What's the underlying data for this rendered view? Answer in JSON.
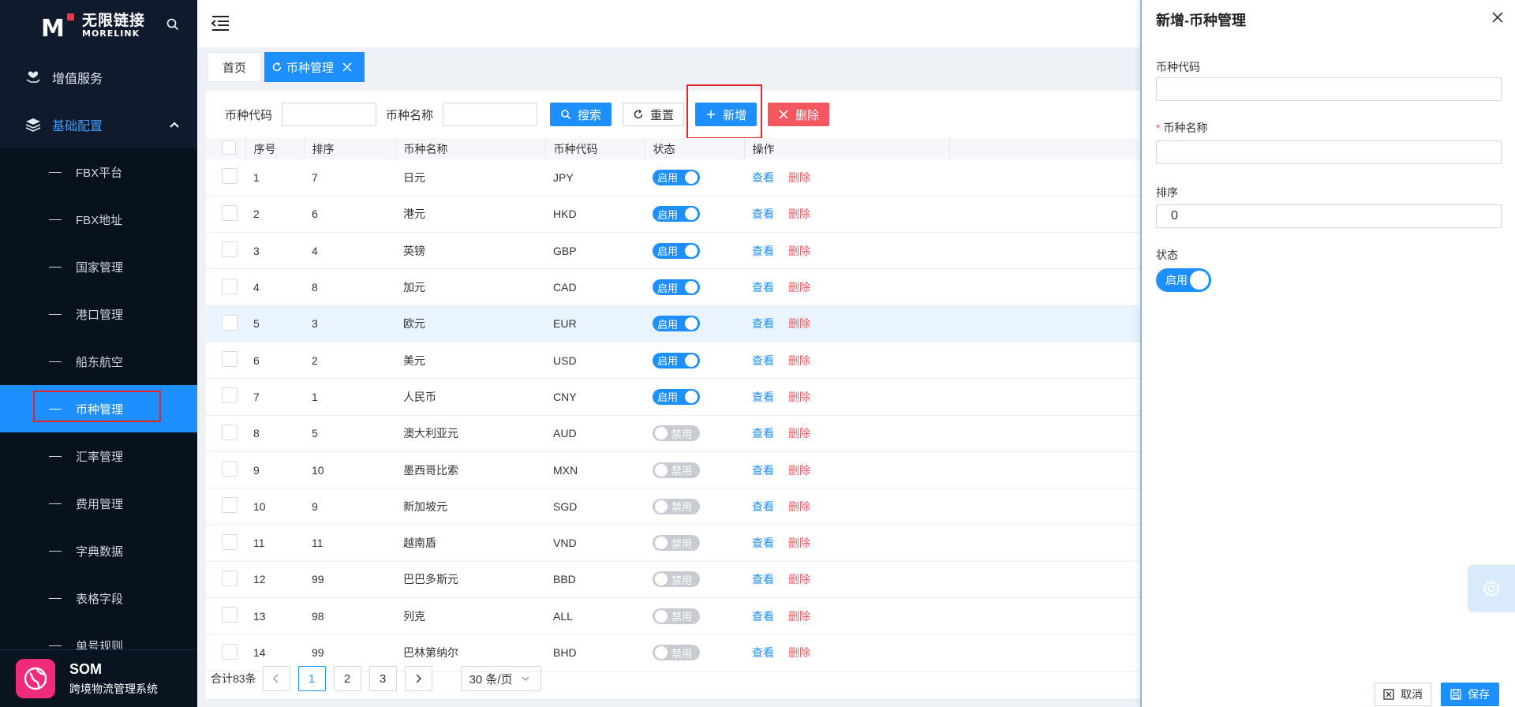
{
  "sidebar": {
    "brand_cn": "无限链接",
    "brand_en": "MORELINK",
    "menus": [
      {
        "label": "增值服务"
      },
      {
        "label": "基础配置"
      }
    ],
    "items": [
      {
        "label": "FBX平台"
      },
      {
        "label": "FBX地址"
      },
      {
        "label": "国家管理"
      },
      {
        "label": "港口管理"
      },
      {
        "label": "船东航空"
      },
      {
        "label": "币种管理"
      },
      {
        "label": "汇率管理"
      },
      {
        "label": "费用管理"
      },
      {
        "label": "字典数据"
      },
      {
        "label": "表格字段"
      },
      {
        "label": "单号规则"
      }
    ],
    "system_name": "SOM",
    "system_desc": "跨境物流管理系统"
  },
  "tabs": [
    {
      "label": "首页"
    },
    {
      "label": "币种管理"
    }
  ],
  "filters": {
    "code_label": "币种代码",
    "name_label": "币种名称",
    "search": "搜索",
    "reset": "重置",
    "add": "新增",
    "delete": "删除"
  },
  "table": {
    "headers": [
      "序号",
      "排序",
      "币种名称",
      "币种代码",
      "状态",
      "操作"
    ],
    "view": "查看",
    "del": "删除",
    "rows": [
      {
        "no": "1",
        "sort": "7",
        "name": "日元",
        "code": "JPY",
        "status": "启用"
      },
      {
        "no": "2",
        "sort": "6",
        "name": "港元",
        "code": "HKD",
        "status": "启用"
      },
      {
        "no": "3",
        "sort": "4",
        "name": "英镑",
        "code": "GBP",
        "status": "启用"
      },
      {
        "no": "4",
        "sort": "8",
        "name": "加元",
        "code": "CAD",
        "status": "启用"
      },
      {
        "no": "5",
        "sort": "3",
        "name": "欧元",
        "code": "EUR",
        "status": "启用"
      },
      {
        "no": "6",
        "sort": "2",
        "name": "美元",
        "code": "USD",
        "status": "启用"
      },
      {
        "no": "7",
        "sort": "1",
        "name": "人民币",
        "code": "CNY",
        "status": "启用"
      },
      {
        "no": "8",
        "sort": "5",
        "name": "澳大利亚元",
        "code": "AUD",
        "status": "禁用"
      },
      {
        "no": "9",
        "sort": "10",
        "name": "墨西哥比索",
        "code": "MXN",
        "status": "禁用"
      },
      {
        "no": "10",
        "sort": "9",
        "name": "新加坡元",
        "code": "SGD",
        "status": "禁用"
      },
      {
        "no": "11",
        "sort": "11",
        "name": "越南盾",
        "code": "VND",
        "status": "禁用"
      },
      {
        "no": "12",
        "sort": "99",
        "name": "巴巴多斯元",
        "code": "BBD",
        "status": "禁用"
      },
      {
        "no": "13",
        "sort": "98",
        "name": "列克",
        "code": "ALL",
        "status": "禁用"
      },
      {
        "no": "14",
        "sort": "99",
        "name": "巴林第纳尔",
        "code": "BHD",
        "status": "禁用"
      }
    ]
  },
  "pager": {
    "total": "合计83条",
    "pages": [
      "1",
      "2",
      "3"
    ],
    "page_size": "30 条/页"
  },
  "drawer": {
    "title": "新增-币种管理",
    "code_label": "币种代码",
    "name_label": "币种名称",
    "required_mark": "*",
    "sort_label": "排序",
    "sort_value": "0",
    "status_label": "状态",
    "status_value": "启用",
    "cancel": "取消",
    "save": "保存"
  },
  "colors": {
    "primary": "#1e8fff",
    "danger": "#f45760",
    "sidebar_bg": "#0f1b2d",
    "highlight": "#e3242b"
  }
}
